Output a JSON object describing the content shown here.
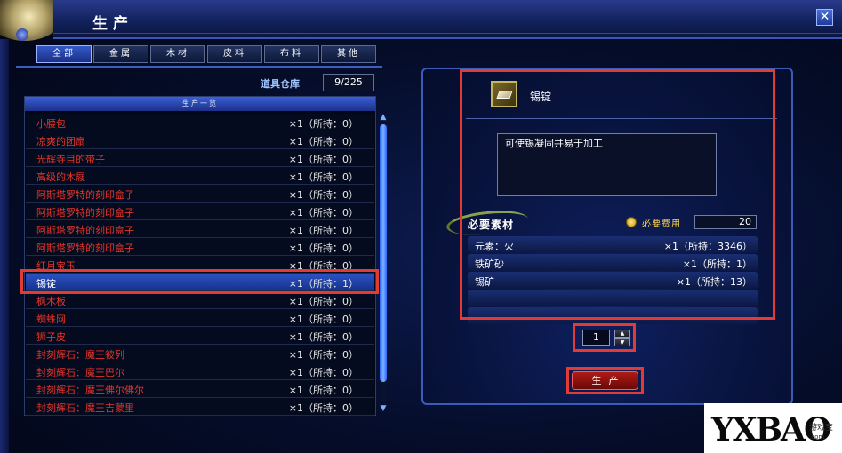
{
  "window": {
    "title": "生产"
  },
  "tabs": [
    "全部",
    "金属",
    "木材",
    "皮料",
    "布料",
    "其他"
  ],
  "storage": {
    "label": "道具仓库",
    "count": "9/225"
  },
  "list": {
    "header": "生产一览",
    "rows": [
      {
        "name": "小腰包",
        "qty": "×1（所持：0）"
      },
      {
        "name": "凉爽的团扇",
        "qty": "×1（所持：0）"
      },
      {
        "name": "光辉寺目的带子",
        "qty": "×1（所持：0）"
      },
      {
        "name": "高级的木屐",
        "qty": "×1（所持：0）"
      },
      {
        "name": "阿斯塔罗特的刻印盒子",
        "qty": "×1（所持：0）"
      },
      {
        "name": "阿斯塔罗特的刻印盒子",
        "qty": "×1（所持：0）"
      },
      {
        "name": "阿斯塔罗特的刻印盒子",
        "qty": "×1（所持：0）"
      },
      {
        "name": "阿斯塔罗特的刻印盒子",
        "qty": "×1（所持：0）"
      },
      {
        "name": "红月宝玉",
        "qty": "×1（所持：0）"
      },
      {
        "name": "锡锭",
        "qty": "×1（所持：1）"
      },
      {
        "name": "枫木板",
        "qty": "×1（所持：0）"
      },
      {
        "name": "蜘蛛网",
        "qty": "×1（所持：0）"
      },
      {
        "name": "狮子皮",
        "qty": "×1（所持：0）"
      },
      {
        "name": "封刻辉石：魔王彼列",
        "qty": "×1（所持：0）"
      },
      {
        "name": "封刻辉石：魔王巴尔",
        "qty": "×1（所持：0）"
      },
      {
        "name": "封刻辉石：魔王佛尔佛尔",
        "qty": "×1（所持：0）"
      },
      {
        "name": "封刻辉石：魔王吉蒙里",
        "qty": "×1（所持：0）"
      }
    ],
    "selected_index": 9
  },
  "detail": {
    "item_name": "锡锭",
    "item_icon": "tin-ingot-icon",
    "description": "可使锡凝固并易于加工",
    "required_title": "必要素材",
    "cost_label": "必要费用",
    "cost_value": "20",
    "materials": [
      {
        "name": "元素：火",
        "qty": "×1（所持：3346）"
      },
      {
        "name": "铁矿砂",
        "qty": "×1（所持：1）"
      },
      {
        "name": "锡矿",
        "qty": "×1（所持：13）"
      },
      {
        "name": "",
        "qty": ""
      },
      {
        "name": "",
        "qty": ""
      }
    ]
  },
  "quantity": "1",
  "produce_button": "生产",
  "watermark": {
    "text": "YXBAO",
    "sub": "游戏宝",
    "url": ".com"
  },
  "colors": {
    "highlight": "#e23a34",
    "item_text": "#e4342a",
    "accent": "#3b5dc0"
  }
}
